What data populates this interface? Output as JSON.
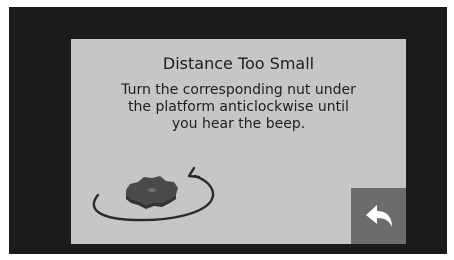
{
  "dialog": {
    "title": "Distance Too Small",
    "message_lines": [
      "Turn the corresponding nut under",
      "the platform anticlockwise until",
      "you hear the beep."
    ]
  },
  "illustration": {
    "icons": [
      "nut-icon",
      "anticlockwise-arrow-icon"
    ]
  },
  "back_button": {
    "icon": "back-arrow-icon"
  },
  "colors": {
    "bezel": "#1b1b1b",
    "screen_background": "#c6c6c6",
    "text": "#1e1e1e",
    "back_button_background": "#6c6c6c",
    "back_icon": "#ffffff",
    "nut": "#4a4a4a"
  }
}
